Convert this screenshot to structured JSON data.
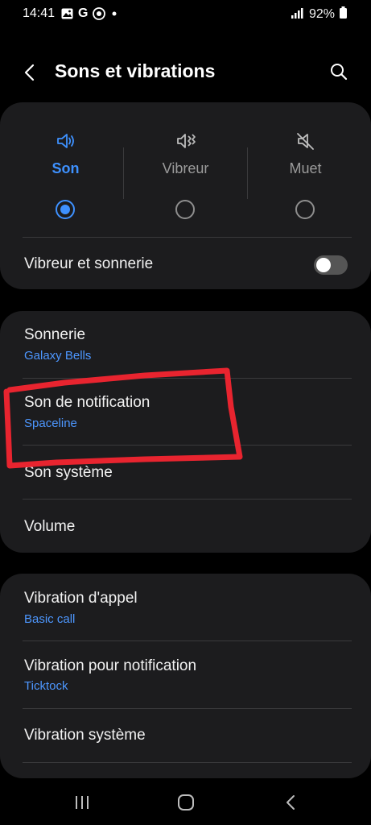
{
  "status_bar": {
    "time": "14:41",
    "icons": [
      "gallery-icon",
      "google-icon",
      "app-icon",
      "dot-icon"
    ],
    "battery": "92%"
  },
  "header": {
    "title": "Sons et vibrations"
  },
  "sound_modes": [
    {
      "label": "Son",
      "icon": "speaker-icon",
      "selected": true
    },
    {
      "label": "Vibreur",
      "icon": "vibrate-icon",
      "selected": false
    },
    {
      "label": "Muet",
      "icon": "mute-icon",
      "selected": false
    }
  ],
  "vibrate_ring": {
    "label": "Vibreur et sonnerie",
    "enabled": false
  },
  "sound_settings": {
    "ringtone": {
      "title": "Sonnerie",
      "value": "Galaxy Bells"
    },
    "notification_sound": {
      "title": "Son de notification",
      "value": "Spaceline"
    },
    "system_sound": {
      "title": "Son système"
    },
    "volume": {
      "title": "Volume"
    }
  },
  "vibration_settings": {
    "call_vibration": {
      "title": "Vibration d'appel",
      "value": "Basic call"
    },
    "notification_vibration": {
      "title": "Vibration pour notification",
      "value": "Ticktock"
    },
    "system_vibration": {
      "title": "Vibration système"
    }
  },
  "colors": {
    "accent": "#3e91ff",
    "card": "#1c1c1e",
    "annotation": "#e8242f"
  }
}
